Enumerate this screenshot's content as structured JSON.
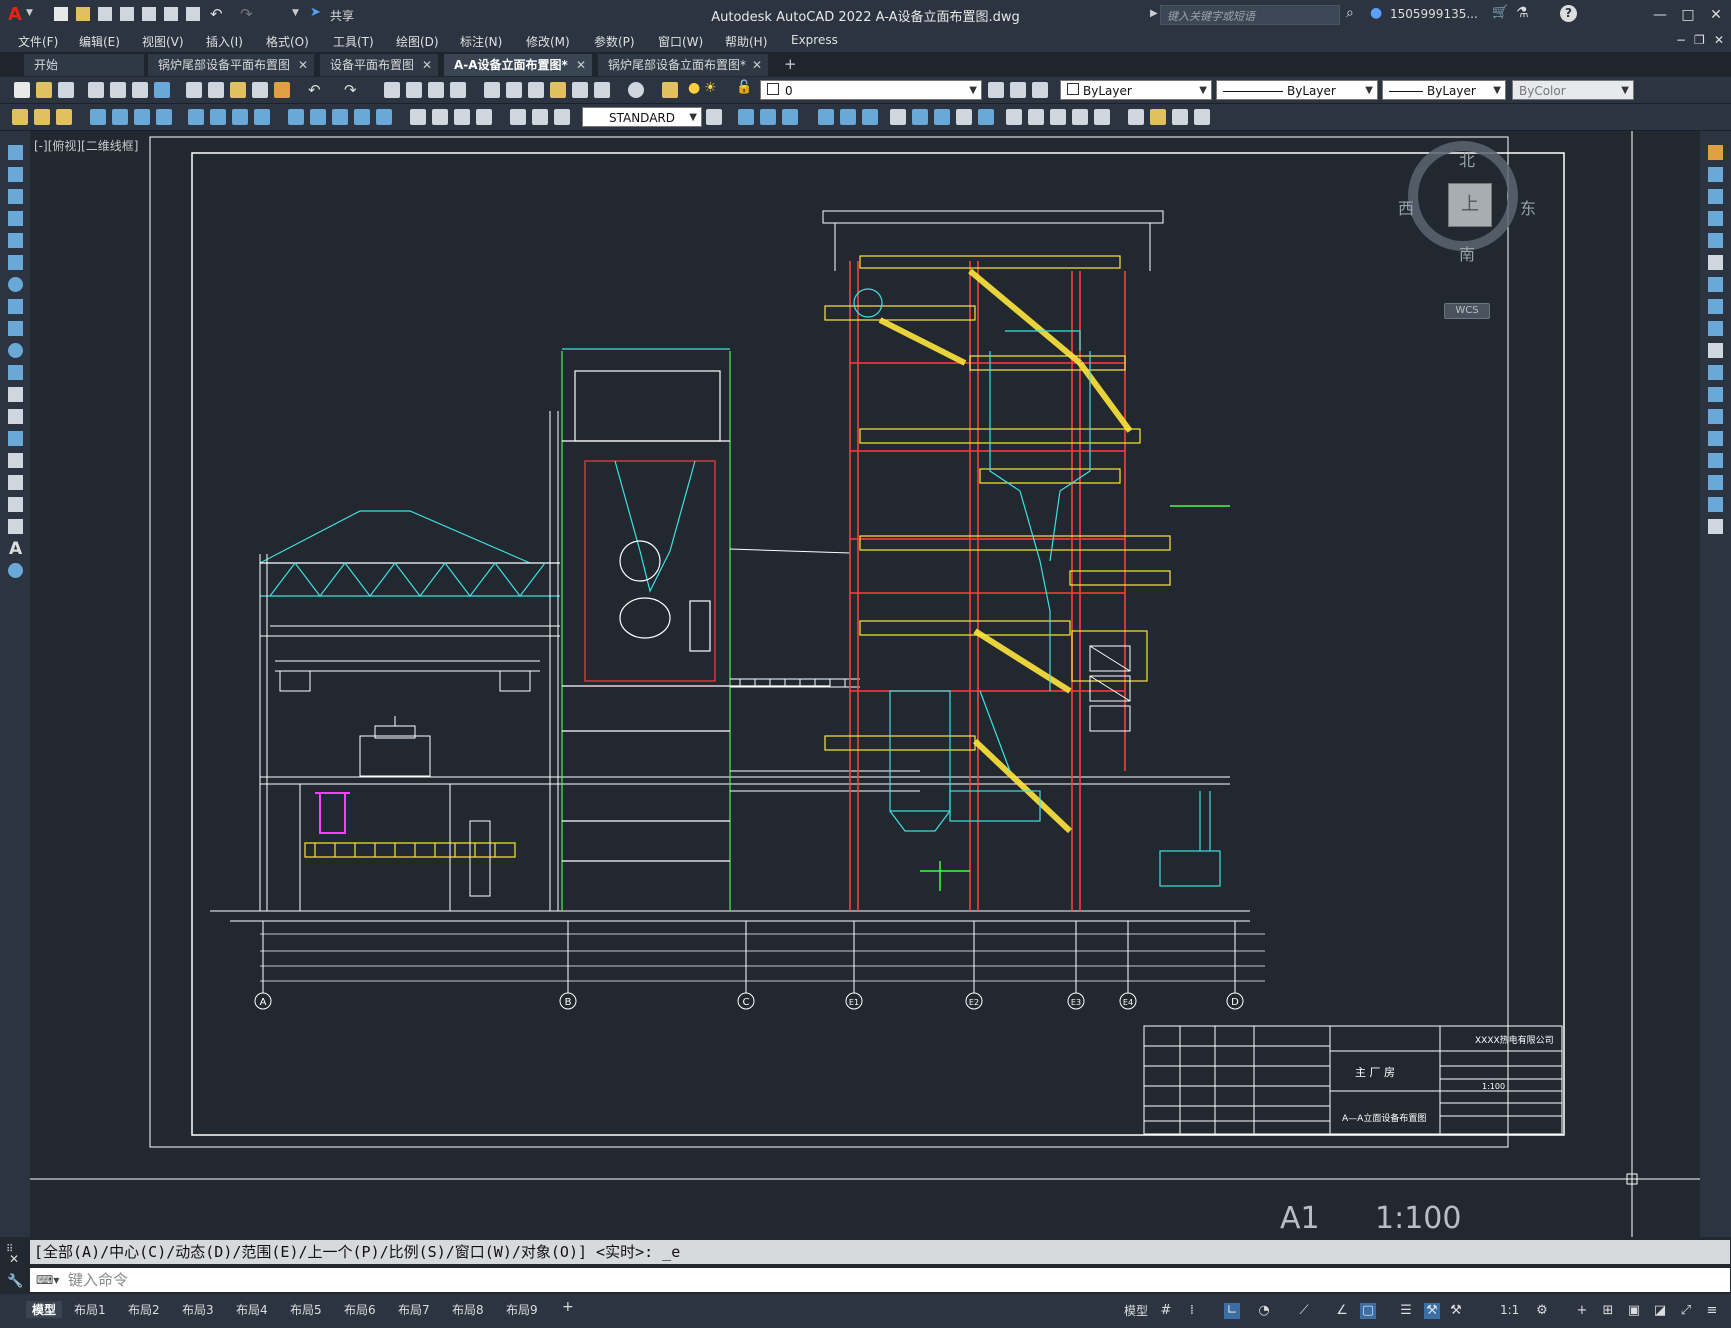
{
  "app": {
    "title": "Autodesk AutoCAD 2022    A-A设备立面布置图.dwg",
    "share": "共享",
    "search_placeholder": "键入关键字或短语",
    "user": "1505999135...",
    "logo": "A"
  },
  "menu": [
    "文件(F)",
    "编辑(E)",
    "视图(V)",
    "插入(I)",
    "格式(O)",
    "工具(T)",
    "绘图(D)",
    "标注(N)",
    "修改(M)",
    "参数(P)",
    "窗口(W)",
    "帮助(H)",
    "Express"
  ],
  "tabs": [
    {
      "label": "开始",
      "closable": false
    },
    {
      "label": "锅炉尾部设备平面布置图",
      "closable": true
    },
    {
      "label": "设备平面布置图",
      "closable": true
    },
    {
      "label": "A-A设备立面布置图*",
      "closable": true,
      "active": true
    },
    {
      "label": "锅炉尾部设备立面布置图*",
      "closable": true
    }
  ],
  "toolbar": {
    "layer": "0",
    "color": "ByLayer",
    "linetype": "ByLayer",
    "lineweight": "ByLayer",
    "plotstyle": "ByColor",
    "textstyle": "STANDARD"
  },
  "viewport_label": "[-][俯视][二维线框]",
  "viewcube": {
    "north": "北",
    "south": "南",
    "east": "东",
    "west": "西",
    "top": "上",
    "wcs": "WCS"
  },
  "paper": {
    "size": "A1",
    "scale": "1:100"
  },
  "drawing": {
    "grid_labels": [
      "A",
      "B",
      "C",
      "E1",
      "E2",
      "E3",
      "E4",
      "D"
    ],
    "title_block": {
      "company": "XXXX热电有限公司",
      "subtitle": "主  厂  房",
      "drawing_name": "A—A立面设备布置图",
      "scale": "1:100"
    }
  },
  "command": {
    "history": "[全部(A)/中心(C)/动态(D)/范围(E)/上一个(P)/比例(S)/窗口(W)/对象(O)] <实时>: _e",
    "placeholder": "键入命令"
  },
  "layouts": [
    "模型",
    "布局1",
    "布局2",
    "布局3",
    "布局4",
    "布局5",
    "布局6",
    "布局7",
    "布局8",
    "布局9"
  ],
  "status": {
    "model": "模型",
    "scale": "1:1"
  }
}
